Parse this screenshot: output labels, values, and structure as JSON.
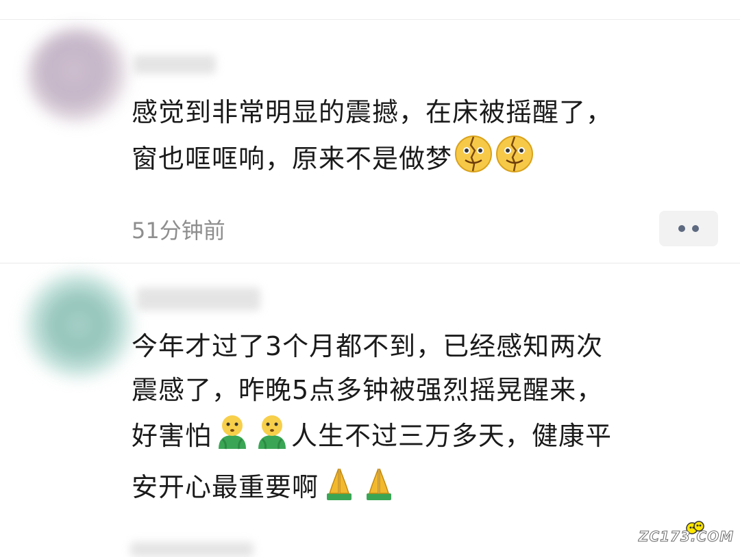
{
  "comments": [
    {
      "text_line1": "感觉到非常明显的震撼，在床被摇醒了，",
      "text_line2": "窗也哐哐响，原来不是做梦",
      "emoji": [
        "cracked-face-icon",
        "cracked-face-icon"
      ],
      "time": "51分钟前"
    },
    {
      "text_line1": "今年才过了3个月都不到，已经感知两次",
      "text_line2": "震感了，昨晚5点多钟被强烈摇晃醒来，",
      "text_line3a": "好害怕",
      "text_line3b": "人生不过三万多天，健康平",
      "text_line4": "安开心最重要啊",
      "emoji_afraid": [
        "scared-person-icon",
        "scared-person-icon"
      ],
      "emoji_pray": [
        "praying-hands-icon",
        "praying-hands-icon"
      ]
    }
  ],
  "watermark": "ZC173.COM",
  "colors": {
    "text": "#1a1a1a",
    "time": "#8e8e8e",
    "more_dots": "#5d6a80",
    "more_bg": "#f2f2f2"
  }
}
